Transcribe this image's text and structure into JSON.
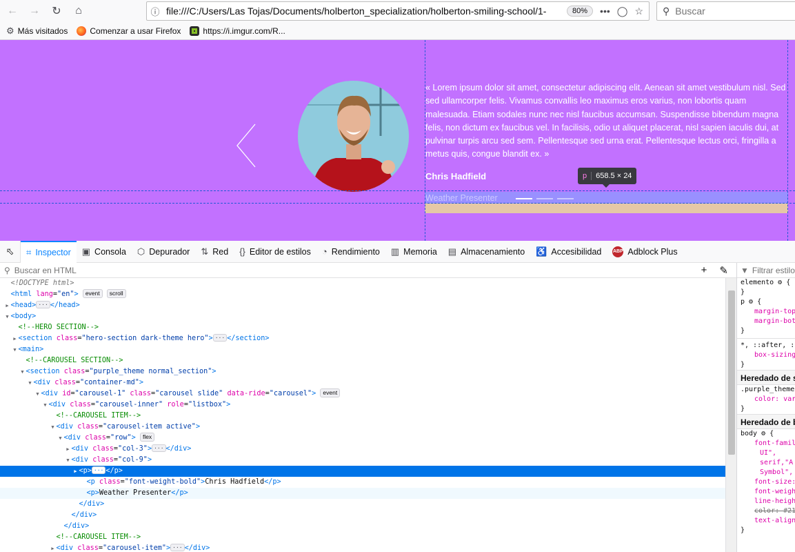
{
  "browser": {
    "url": "file:///C:/Users/Las Tojas/Documents/holberton_specialization/holberton-smiling-school/1-",
    "zoom": "80%",
    "search_placeholder": "Buscar",
    "bookmarks": [
      {
        "label": "Más visitados",
        "icon": "gear-icon"
      },
      {
        "label": "Comenzar a usar Firefox",
        "icon": "firefox-icon"
      },
      {
        "label": "https://i.imgur.com/R...",
        "icon": "imgur-icon"
      }
    ]
  },
  "page": {
    "quote": "« Lorem ipsum dolor sit amet, consectetur adipiscing elit. Aenean sit amet vestibulum nisl. Sed sed ullamcorper felis. Vivamus convallis leo maximus eros varius, non lobortis quam malesuada. Etiam sodales nunc nec nisl faucibus accumsan. Suspendisse bibendum magna felis, non dictum ex faucibus vel. In facilisis, odio ut aliquet placerat, nisl sapien iaculis dui, at pulvinar turpis arcu sed sem. Pellentesque sed urna erat. Pellentesque lectus orci, fringilla a metus quis, congue blandit ex. »",
    "author": "Chris Hadfield",
    "role": "Weather Presenter",
    "infobar_tag": "p",
    "infobar_dims": "658.5 × 24",
    "bg_color": "#c271ff"
  },
  "devtools": {
    "tabs": [
      {
        "label": "Inspector",
        "icon": "inspector-icon",
        "active": true
      },
      {
        "label": "Consola",
        "icon": "console-icon"
      },
      {
        "label": "Depurador",
        "icon": "debugger-icon"
      },
      {
        "label": "Red",
        "icon": "network-icon"
      },
      {
        "label": "Editor de estilos",
        "icon": "style-editor-icon"
      },
      {
        "label": "Rendimiento",
        "icon": "performance-icon"
      },
      {
        "label": "Memoria",
        "icon": "memory-icon"
      },
      {
        "label": "Almacenamiento",
        "icon": "storage-icon"
      },
      {
        "label": "Accesibilidad",
        "icon": "accessibility-icon"
      },
      {
        "label": "Adblock Plus",
        "icon": "adblock-icon"
      }
    ],
    "search_placeholder": "Buscar en HTML",
    "rules_filter_placeholder": "Filtrar estilo",
    "markup": [
      {
        "indent": 1,
        "html": "<span class='dt'>&lt;!DOCTYPE html&gt;</span>"
      },
      {
        "indent": 1,
        "html": "<span class='tg'>&lt;html</span> <span class='an'>lang</span>=<span class='av'>\"en\"</span><span class='tg'>&gt;</span> <span class='badge'>event</span> <span class='badge'>scroll</span>"
      },
      {
        "indent": 1,
        "tw": "▶",
        "html": "<span class='tg'>&lt;head&gt;</span><span class='ell'>···</span><span class='tg'>&lt;/head&gt;</span>"
      },
      {
        "indent": 1,
        "tw": "▼",
        "html": "<span class='tg'>&lt;body&gt;</span>"
      },
      {
        "indent": 3,
        "html": "<span class='cm'>&lt;!--HERO SECTION--&gt;</span>"
      },
      {
        "indent": 3,
        "tw": "▶",
        "html": "<span class='tg'>&lt;section</span> <span class='an'>class</span>=<span class='av'>\"hero-section dark-theme hero\"</span><span class='tg'>&gt;</span><span class='ell'>···</span><span class='tg'>&lt;/section&gt;</span>"
      },
      {
        "indent": 3,
        "tw": "▼",
        "html": "<span class='tg'>&lt;main&gt;</span>"
      },
      {
        "indent": 5,
        "html": "<span class='cm'>&lt;!--CAROUSEL SECTION--&gt;</span>"
      },
      {
        "indent": 5,
        "tw": "▼",
        "html": "<span class='tg'>&lt;section</span> <span class='an'>class</span>=<span class='av'>\"purple_theme normal_section\"</span><span class='tg'>&gt;</span>"
      },
      {
        "indent": 7,
        "tw": "▼",
        "html": "<span class='tg'>&lt;div</span> <span class='an'>class</span>=<span class='av'>\"container-md\"</span><span class='tg'>&gt;</span>"
      },
      {
        "indent": 9,
        "tw": "▼",
        "html": "<span class='tg'>&lt;div</span> <span class='an'>id</span>=<span class='av'>\"carousel-1\"</span> <span class='an'>class</span>=<span class='av'>\"carousel slide\"</span> <span class='an'>data-ride</span>=<span class='av'>\"carousel\"</span><span class='tg'>&gt;</span> <span class='badge'>event</span>"
      },
      {
        "indent": 11,
        "tw": "▼",
        "html": "<span class='tg'>&lt;div</span> <span class='an'>class</span>=<span class='av'>\"carousel-inner\"</span> <span class='an'>role</span>=<span class='av'>\"listbox\"</span><span class='tg'>&gt;</span>"
      },
      {
        "indent": 13,
        "html": "<span class='cm'>&lt;!--CAROUSEL ITEM--&gt;</span>"
      },
      {
        "indent": 13,
        "tw": "▼",
        "html": "<span class='tg'>&lt;div</span> <span class='an'>class</span>=<span class='av'>\"carousel-item active\"</span><span class='tg'>&gt;</span>"
      },
      {
        "indent": 15,
        "tw": "▼",
        "html": "<span class='tg'>&lt;div</span> <span class='an'>class</span>=<span class='av'>\"row\"</span><span class='tg'>&gt;</span> <span class='badge'>flex</span>"
      },
      {
        "indent": 17,
        "tw": "▶",
        "html": "<span class='tg'>&lt;div</span> <span class='an'>class</span>=<span class='av'>\"col-3\"</span><span class='tg'>&gt;</span><span class='ell'>···</span><span class='tg'>&lt;/div&gt;</span>"
      },
      {
        "indent": 17,
        "tw": "▼",
        "html": "<span class='tg'>&lt;div</span> <span class='an'>class</span>=<span class='av'>\"col-9\"</span><span class='tg'>&gt;</span>"
      },
      {
        "indent": 19,
        "tw": "▶",
        "selected": true,
        "html": "<span class='tg'>&lt;p&gt;</span><span class='ell'>···</span><span class='tg'>&lt;/p&gt;</span>"
      },
      {
        "indent": 21,
        "html": "<span class='tg'>&lt;p</span> <span class='an'>class</span>=<span class='av'>\"font-weight-bold\"</span><span class='tg'>&gt;</span>Chris Hadfield<span class='tg'>&lt;/p&gt;</span>"
      },
      {
        "indent": 21,
        "hover": true,
        "html": "<span class='tg'>&lt;p&gt;</span>Weather Presenter<span class='tg'>&lt;/p&gt;</span>"
      },
      {
        "indent": 19,
        "html": "<span class='tg'>&lt;/div&gt;</span>"
      },
      {
        "indent": 17,
        "html": "<span class='tg'>&lt;/div&gt;</span>"
      },
      {
        "indent": 15,
        "html": "<span class='tg'>&lt;/div&gt;</span>"
      },
      {
        "indent": 13,
        "html": "<span class='cm'>&lt;!--CAROUSEL ITEM--&gt;</span>"
      },
      {
        "indent": 13,
        "tw": "▶",
        "html": "<span class='tg'>&lt;div</span> <span class='an'>class</span>=<span class='av'>\"carousel-item\"</span><span class='tg'>&gt;</span><span class='ell'>···</span><span class='tg'>&lt;/div&gt;</span>"
      }
    ],
    "rules": [
      {
        "cls": "",
        "text": "elemento ⚙ {"
      },
      {
        "cls": "",
        "text": "}"
      },
      {
        "cls": "",
        "text": "p ⚙ {"
      },
      {
        "cls": "prop",
        "text": "margin-top"
      },
      {
        "cls": "prop",
        "text": "margin-bot"
      },
      {
        "cls": "",
        "text": "}"
      },
      {
        "cls": "sep",
        "text": ""
      },
      {
        "cls": "",
        "text": "*, ::after, :"
      },
      {
        "cls": "prop",
        "text": "box-sizing"
      },
      {
        "cls": "",
        "text": "}"
      },
      {
        "cls": "head",
        "text": "Heredado de se"
      },
      {
        "cls": "",
        "text": ".purple_theme"
      },
      {
        "cls": "prop",
        "text": "color: var"
      },
      {
        "cls": "",
        "text": "}"
      },
      {
        "cls": "head",
        "text": "Heredado de bo"
      },
      {
        "cls": "",
        "text": "body ⚙ {"
      },
      {
        "cls": "prop",
        "text": "font-famil"
      },
      {
        "cls": "val",
        "text": "UI\","
      },
      {
        "cls": "val",
        "text": "serif,\"A"
      },
      {
        "cls": "val",
        "text": "Symbol\","
      },
      {
        "cls": "prop",
        "text": "font-size:"
      },
      {
        "cls": "prop",
        "text": "font-weigh"
      },
      {
        "cls": "prop",
        "text": "line-heigh"
      },
      {
        "cls": "strike",
        "text": "color: #21"
      },
      {
        "cls": "prop",
        "text": "text-align"
      },
      {
        "cls": "",
        "text": "}"
      }
    ]
  }
}
